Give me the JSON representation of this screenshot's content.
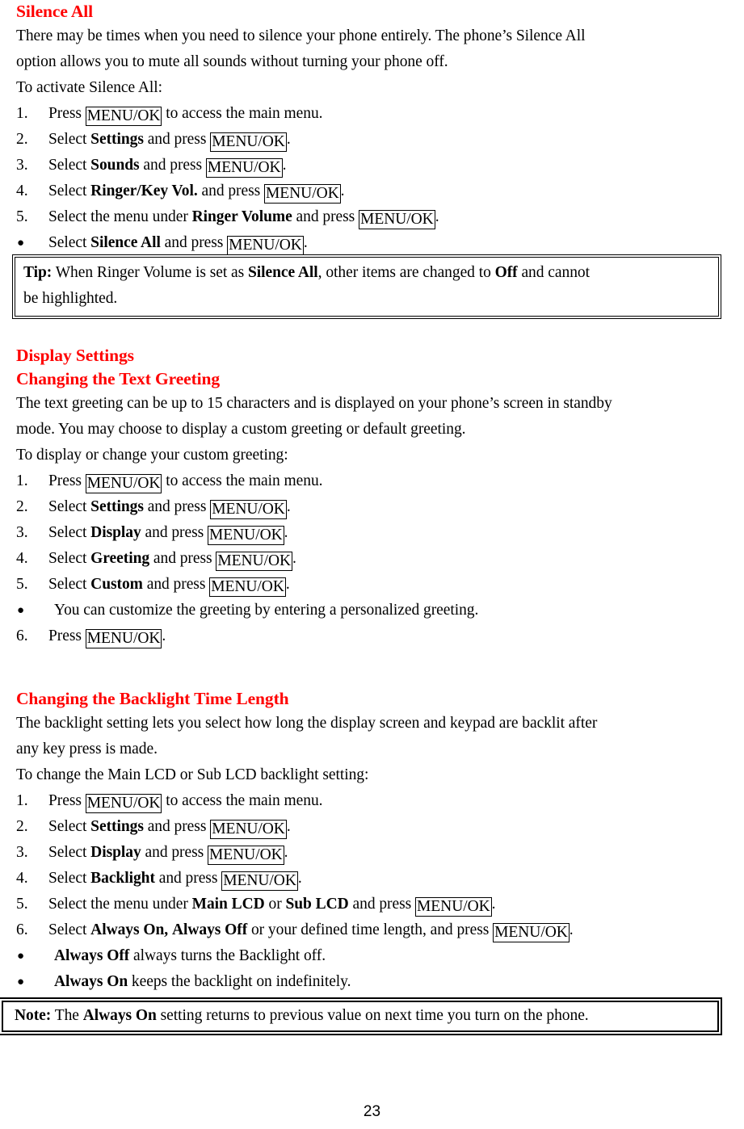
{
  "document": {
    "page_number": "23",
    "accent_color": "#ff0000",
    "text_color": "#000000",
    "key_label": "MENU/OK"
  },
  "sections": {
    "silence_all": {
      "heading": "Silence All",
      "intro_line_1": "There may be times when you need to silence your phone entirely. The phone’s Silence All",
      "intro_line_2": "option allows you to mute all sounds without turning your phone off.",
      "lead_in": "To activate Silence All:",
      "steps": [
        {
          "marker": "1.",
          "pre": "Press ",
          "key": "MENU/OK",
          "post": " to access the main menu."
        },
        {
          "marker": "2.",
          "pre": "Select ",
          "bold": "Settings",
          "mid": " and press ",
          "key": "MENU/OK",
          "post": "."
        },
        {
          "marker": "3.",
          "pre": "Select ",
          "bold": "Sounds",
          "mid": " and press ",
          "key": "MENU/OK",
          "post": "."
        },
        {
          "marker": "4.",
          "pre": "Select ",
          "bold": "Ringer/Key Vol.",
          "mid": " and press ",
          "key": "MENU/OK",
          "post": "."
        },
        {
          "marker": "5.",
          "pre": "Select the menu under ",
          "bold": "Ringer Volume",
          "mid": " and press ",
          "key": "MENU/OK",
          "post": "."
        },
        {
          "marker": "●",
          "pre": "Select ",
          "bold": "Silence All",
          "mid": " and press ",
          "key": "MENU/OK",
          "post": "."
        }
      ],
      "tip": {
        "label": "Tip:",
        "line_1_a": " When Ringer Volume is set as ",
        "line_1_bold_1": "Silence All",
        "line_1_b": ", other items are changed to ",
        "line_1_bold_2": "Off",
        "line_1_c": " and cannot",
        "line_2": "be highlighted."
      }
    },
    "display_settings": {
      "heading": "Display Settings",
      "subheading": "Changing the Text Greeting",
      "intro_line_1": "The text greeting can be up to 15 characters and is displayed on your phone’s screen in standby",
      "intro_line_2": "mode. You may choose to display a custom greeting or default greeting.",
      "lead_in": "To display or change your custom greeting:",
      "steps": [
        {
          "marker": "1.",
          "pre": "Press ",
          "key": "MENU/OK",
          "post": " to access the main menu."
        },
        {
          "marker": "2.",
          "pre": "Select ",
          "bold": "Settings",
          "mid": " and press ",
          "key": "MENU/OK",
          "post": "."
        },
        {
          "marker": "3.",
          "pre": "Select ",
          "bold": "Display",
          "mid": " and press ",
          "key": "MENU/OK",
          "post": "."
        },
        {
          "marker": "4.",
          "pre": "Select ",
          "bold": "Greeting",
          "mid": " and press ",
          "key": "MENU/OK",
          "post": "."
        },
        {
          "marker": "5.",
          "pre": "Select ",
          "bold": "Custom",
          "mid": " and press ",
          "key": "MENU/OK",
          "post": "."
        },
        {
          "marker": "●",
          "pre": "You can customize the greeting by entering a personalized greeting."
        },
        {
          "marker": "6.",
          "pre": "Press ",
          "key": "MENU/OK",
          "post": "."
        }
      ]
    },
    "backlight": {
      "heading": "Changing the Backlight Time Length",
      "intro_line_1": "The backlight setting lets you select how long the display screen and keypad are backlit after",
      "intro_line_2": "any key press is made.",
      "lead_in": "To change the Main LCD or Sub LCD backlight setting:",
      "steps": [
        {
          "marker": "1.",
          "pre": "Press ",
          "key": "MENU/OK",
          "post": " to access the main menu."
        },
        {
          "marker": "2.",
          "pre": "Select ",
          "bold": "Settings",
          "mid": " and press ",
          "key": "MENU/OK",
          "post": "."
        },
        {
          "marker": "3.",
          "pre": "Select ",
          "bold": "Display",
          "mid": " and press ",
          "key": "MENU/OK",
          "post": "."
        },
        {
          "marker": "4.",
          "pre": "Select ",
          "bold": "Backlight",
          "mid": " and press ",
          "key": "MENU/OK",
          "post": "."
        },
        {
          "marker": "5.",
          "pre": "Select the menu under ",
          "bold": "Main LCD",
          "mid": " or ",
          "bold2": "Sub LCD",
          "mid2": " and press ",
          "key": "MENU/OK",
          "post": "."
        },
        {
          "marker": "6.",
          "pre": "Select ",
          "bold": "Always On,",
          "mid": " ",
          "bold2": "Always Off",
          "mid2": " or your defined time length, and press ",
          "key": "MENU/OK",
          "post": "."
        },
        {
          "marker": "●",
          "bold": "Always Off",
          "mid": " always turns the Backlight off."
        },
        {
          "marker": "●",
          "bold": "Always On",
          "mid": " keeps the backlight on indefinitely."
        }
      ],
      "note": {
        "label": "Note:",
        "text_a": " The ",
        "bold": "Always On",
        "text_b": " setting returns to previous value on next time you turn on the phone."
      }
    }
  }
}
